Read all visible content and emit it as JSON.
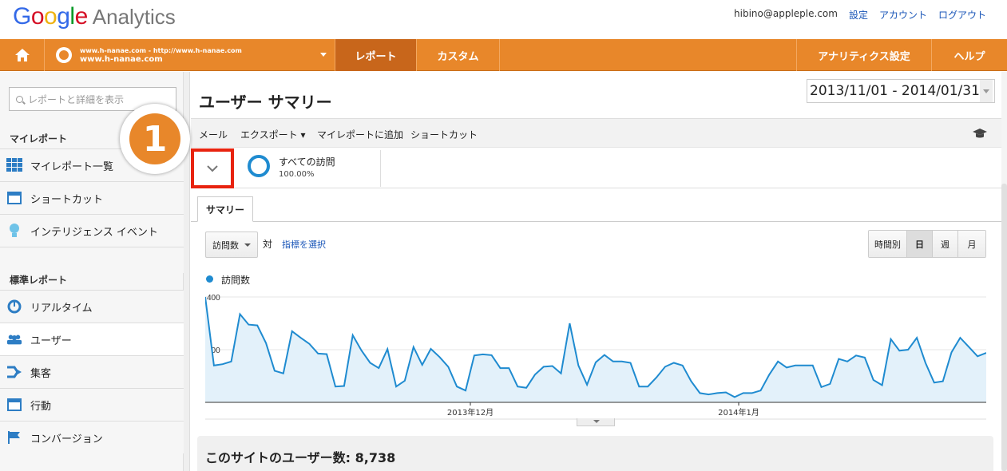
{
  "header": {
    "logo_google": "Google",
    "logo_product": "Analytics",
    "email": "hibino@appleple.com",
    "links": [
      "設定",
      "アカウント",
      "ログアウト"
    ]
  },
  "nav": {
    "site_line1": "www.h-nanae.com - http://www.h-nanae.com",
    "site_line2": "www.h-nanae.com",
    "report": "レポート",
    "custom": "カスタム",
    "analytics_settings": "アナリティクス設定",
    "help": "ヘルプ"
  },
  "sidebar": {
    "search_placeholder": "レポートと詳細を表示",
    "my_reports_heading": "マイレポート",
    "my_items": [
      "マイレポート一覧",
      "ショートカット",
      "インテリジェンス イベント"
    ],
    "standard_heading": "標準レポート",
    "standard_items": [
      "リアルタイム",
      "ユーザー",
      "集客",
      "行動",
      "コンバージョン"
    ]
  },
  "main": {
    "title": "ユーザー サマリー",
    "date_range": "2013/11/01 - 2014/01/31",
    "toolbar": [
      "メール",
      "エクスポート ▾",
      "マイレポートに追加",
      "ショートカット"
    ],
    "segment_name": "すべての訪問",
    "segment_pct": "100.00%",
    "annotation_number": "1",
    "tab": "サマリー",
    "metric": "訪問数",
    "vs": "対",
    "choose_metric": "指標を選択",
    "granularity": [
      "時間別",
      "日",
      "週",
      "月"
    ],
    "legend": "訪問数",
    "summary_text": "このサイトのユーザー数: 8,738"
  },
  "colors": {
    "accent": "#e8872a",
    "series": "#1f8bd0",
    "highlight": "#e8230f"
  },
  "chart_data": {
    "type": "area",
    "series": [
      {
        "name": "訪問数",
        "values": [
          400,
          140,
          145,
          155,
          335,
          295,
          292,
          225,
          120,
          110,
          270,
          245,
          222,
          185,
          183,
          60,
          62,
          255,
          197,
          150,
          130,
          202,
          60,
          82,
          210,
          142,
          203,
          172,
          135,
          60,
          45,
          178,
          182,
          179,
          130,
          130,
          60,
          55,
          105,
          135,
          138,
          110,
          300,
          140,
          67,
          152,
          180,
          155,
          155,
          150,
          60,
          60,
          95,
          135,
          150,
          140,
          80,
          35,
          30,
          35,
          38,
          20,
          35,
          35,
          45,
          105,
          155,
          132,
          140,
          140,
          140,
          58,
          70,
          165,
          155,
          178,
          170,
          85,
          65,
          240,
          196,
          200,
          245,
          150,
          75,
          80,
          190,
          245,
          210,
          175,
          188
        ]
      }
    ],
    "x_ticks": [
      "2013年12月",
      "2014年1月"
    ],
    "y_ticks": [
      200,
      400
    ],
    "ylim": [
      0,
      400
    ]
  }
}
